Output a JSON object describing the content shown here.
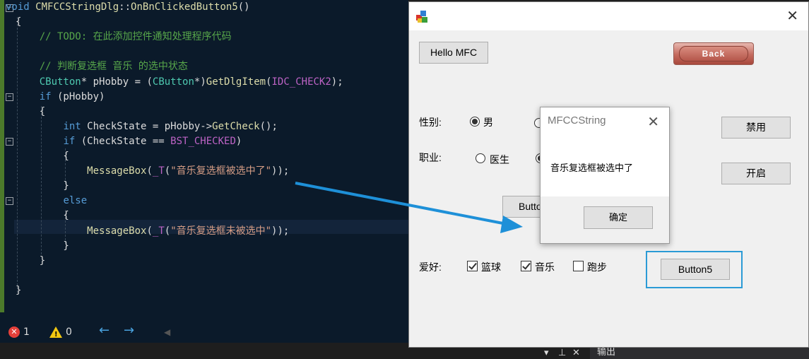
{
  "editor": {
    "lines": [
      {
        "segments": [
          {
            "t": "void ",
            "c": "kw"
          },
          {
            "t": "CMFCCStringDlg",
            "c": "fn"
          },
          {
            "t": "::"
          },
          {
            "t": "OnBnClickedButton5",
            "c": "fn"
          },
          {
            "t": "()"
          }
        ]
      },
      {
        "segments": [
          {
            "t": "{"
          }
        ]
      },
      {
        "segments": [
          {
            "t": "    // TODO: 在此添加控件通知处理程序代码",
            "c": "cm"
          }
        ]
      },
      {
        "segments": [
          {
            "t": ""
          }
        ]
      },
      {
        "segments": [
          {
            "t": "    // 判断复选框 音乐 的选中状态",
            "c": "cm"
          }
        ]
      },
      {
        "segments": [
          {
            "t": "    "
          },
          {
            "t": "CButton",
            "c": "ty"
          },
          {
            "t": "* pHobby = ("
          },
          {
            "t": "CButton",
            "c": "ty"
          },
          {
            "t": "*)"
          },
          {
            "t": "GetDlgItem",
            "c": "fn"
          },
          {
            "t": "("
          },
          {
            "t": "IDC_CHECK2",
            "c": "mc"
          },
          {
            "t": ");"
          }
        ]
      },
      {
        "segments": [
          {
            "t": "    "
          },
          {
            "t": "if",
            "c": "kw"
          },
          {
            "t": " (pHobby)"
          }
        ]
      },
      {
        "segments": [
          {
            "t": "    {"
          }
        ]
      },
      {
        "segments": [
          {
            "t": "        "
          },
          {
            "t": "int",
            "c": "kw"
          },
          {
            "t": " CheckState = pHobby->"
          },
          {
            "t": "GetCheck",
            "c": "fn"
          },
          {
            "t": "();"
          }
        ]
      },
      {
        "segments": [
          {
            "t": "        "
          },
          {
            "t": "if",
            "c": "kw"
          },
          {
            "t": " (CheckState == "
          },
          {
            "t": "BST_CHECKED",
            "c": "mc"
          },
          {
            "t": ")"
          }
        ]
      },
      {
        "segments": [
          {
            "t": "        {"
          }
        ]
      },
      {
        "segments": [
          {
            "t": "            "
          },
          {
            "t": "MessageBox",
            "c": "fn"
          },
          {
            "t": "("
          },
          {
            "t": "_T",
            "c": "mc"
          },
          {
            "t": "("
          },
          {
            "t": "\"音乐复选框被选中了\"",
            "c": "str"
          },
          {
            "t": "));"
          }
        ]
      },
      {
        "segments": [
          {
            "t": "        }"
          }
        ]
      },
      {
        "segments": [
          {
            "t": "        "
          },
          {
            "t": "else",
            "c": "kw"
          }
        ]
      },
      {
        "segments": [
          {
            "t": "        {"
          }
        ]
      },
      {
        "segments": [
          {
            "t": "            "
          },
          {
            "t": "MessageBox",
            "c": "fn"
          },
          {
            "t": "("
          },
          {
            "t": "_T",
            "c": "mc"
          },
          {
            "t": "("
          },
          {
            "t": "\"音乐复选框未被选中\"",
            "c": "str"
          },
          {
            "t": "));"
          }
        ]
      },
      {
        "segments": [
          {
            "t": "        }"
          }
        ]
      },
      {
        "segments": [
          {
            "t": "    }"
          }
        ]
      },
      {
        "segments": [
          {
            "t": ""
          }
        ]
      },
      {
        "segments": [
          {
            "t": "}"
          }
        ]
      }
    ]
  },
  "status": {
    "errors": "1",
    "warnings": "0",
    "error_icon": "error-icon",
    "warning_icon": "warning-icon",
    "prev_icon": "←",
    "next_icon": "→",
    "collapse_icon": "◀",
    "error_glyph": "✕",
    "warning_glyph": "!"
  },
  "output_panel": {
    "title": "输出",
    "dropdown_glyph": "▾",
    "pin_glyph": "⊥",
    "close_glyph": "✕"
  },
  "mfc_window": {
    "close_glyph": "✕",
    "hello_button": "Hello MFC",
    "back_button": "Back",
    "gender_label": "性别:",
    "gender_male": "男",
    "gender_selected": "male",
    "job_label": "职业:",
    "job_doctor": "医生",
    "disable_button": "禁用",
    "enable_button": "开启",
    "button4_partial": "Butto",
    "hobby_label": "爱好:",
    "hobby_basketball": "篮球",
    "hobby_music": "音乐",
    "hobby_running": "跑步",
    "hobby_basketball_checked": true,
    "hobby_music_checked": true,
    "hobby_running_checked": false,
    "button5": "Button5"
  },
  "message_box": {
    "title": "MFCCString",
    "close_glyph": "✕",
    "text": "音乐复选框被选中了",
    "ok_button": "确定"
  },
  "colors": {
    "editor_bg": "#0b1a2a",
    "arrow": "#1e90d8",
    "focus_frame": "#2b9bd6",
    "back_button": "#c46a5e"
  }
}
